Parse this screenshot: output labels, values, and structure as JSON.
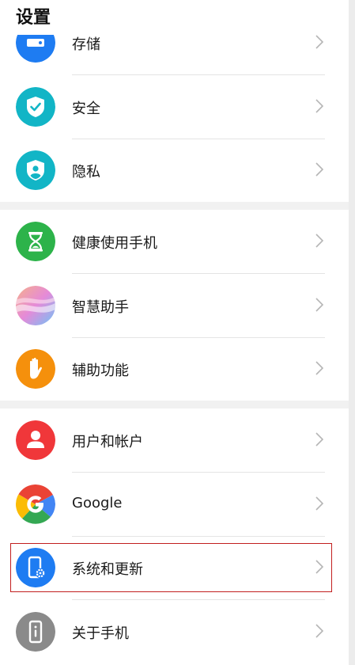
{
  "header": {
    "title": "设置"
  },
  "groups": [
    {
      "items": [
        {
          "label": "存储",
          "icon": "storage-icon",
          "color": "#1e7cf2"
        },
        {
          "label": "安全",
          "icon": "shield-check-icon",
          "color": "#12b5c6"
        },
        {
          "label": "隐私",
          "icon": "privacy-shield-icon",
          "color": "#12b5c6"
        }
      ]
    },
    {
      "items": [
        {
          "label": "健康使用手机",
          "icon": "hourglass-icon",
          "color": "#2db34a"
        },
        {
          "label": "智慧助手",
          "icon": "smart-assistant-icon",
          "color": "#c58cf0"
        },
        {
          "label": "辅助功能",
          "icon": "hand-icon",
          "color": "#f5900c"
        }
      ]
    },
    {
      "items": [
        {
          "label": "用户和帐户",
          "icon": "user-icon",
          "color": "#f0373a"
        },
        {
          "label": "Google",
          "icon": "google-icon",
          "color": "#4285f4"
        },
        {
          "label": "系统和更新",
          "icon": "phone-settings-icon",
          "color": "#1e7cf2"
        },
        {
          "label": "关于手机",
          "icon": "phone-info-icon",
          "color": "#8a8a8a"
        }
      ]
    }
  ]
}
